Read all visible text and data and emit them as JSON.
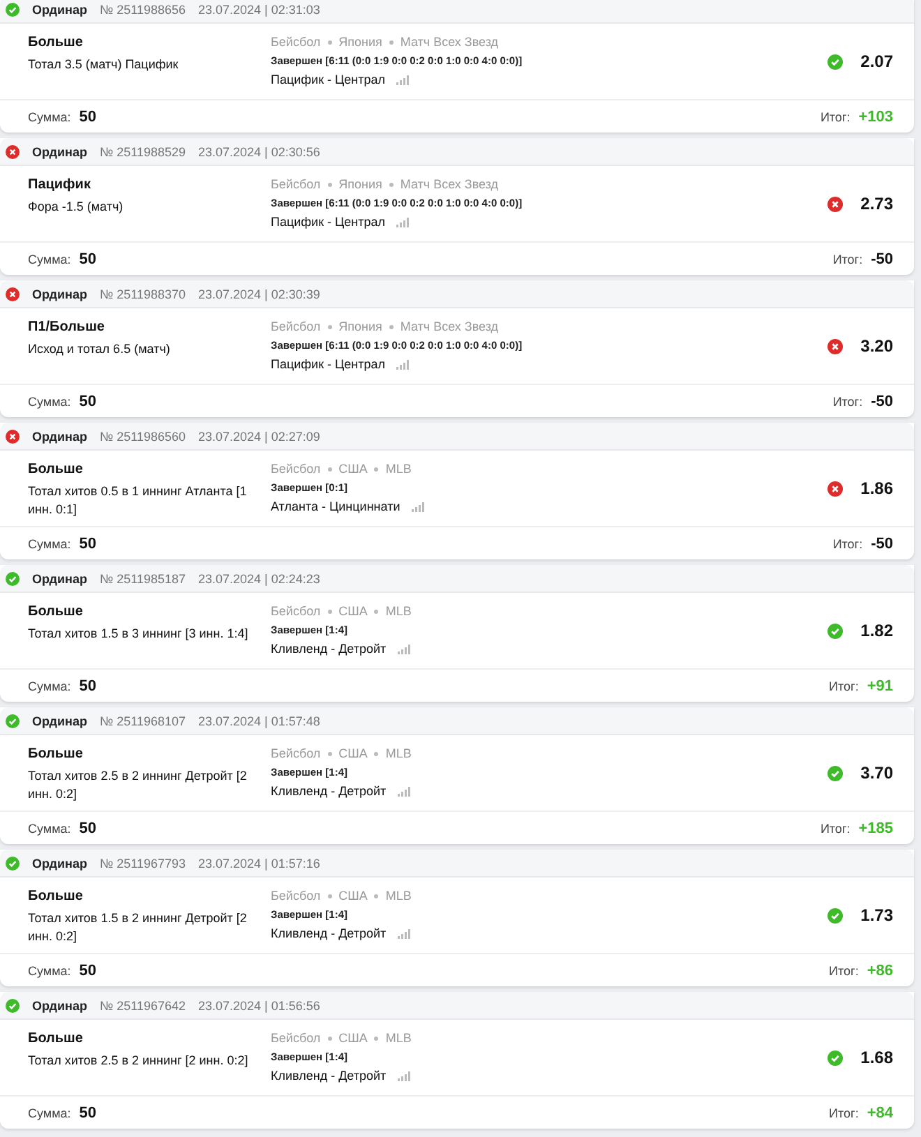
{
  "bets": [
    {
      "won": true,
      "type": "Ординар",
      "number": "№ 2511988656",
      "datetime": "23.07.2024 | 02:31:03",
      "pick": "Больше",
      "market": "Тотал 3.5 (матч) Пацифик",
      "path": [
        "Бейсбол",
        "Япония",
        "Матч Всех Звезд"
      ],
      "result": "Завершен [6:11 (0:0 1:9 0:0 0:2 0:0 1:0 0:0 4:0 0:0)]",
      "teams": "Пацифик - Централ",
      "odds": "2.07",
      "stake_label": "Сумма:",
      "stake": "50",
      "total_label": "Итог:",
      "total": "+103"
    },
    {
      "won": false,
      "type": "Ординар",
      "number": "№ 2511988529",
      "datetime": "23.07.2024 | 02:30:56",
      "pick": "Пацифик",
      "market": "Фора -1.5 (матч)",
      "path": [
        "Бейсбол",
        "Япония",
        "Матч Всех Звезд"
      ],
      "result": "Завершен [6:11 (0:0 1:9 0:0 0:2 0:0 1:0 0:0 4:0 0:0)]",
      "teams": "Пацифик - Централ",
      "odds": "2.73",
      "stake_label": "Сумма:",
      "stake": "50",
      "total_label": "Итог:",
      "total": "-50"
    },
    {
      "won": false,
      "type": "Ординар",
      "number": "№ 2511988370",
      "datetime": "23.07.2024 | 02:30:39",
      "pick": "П1/Больше",
      "market": "Исход и тотал 6.5 (матч)",
      "path": [
        "Бейсбол",
        "Япония",
        "Матч Всех Звезд"
      ],
      "result": "Завершен [6:11 (0:0 1:9 0:0 0:2 0:0 1:0 0:0 4:0 0:0)]",
      "teams": "Пацифик - Централ",
      "odds": "3.20",
      "stake_label": "Сумма:",
      "stake": "50",
      "total_label": "Итог:",
      "total": "-50"
    },
    {
      "won": false,
      "type": "Ординар",
      "number": "№ 2511986560",
      "datetime": "23.07.2024 | 02:27:09",
      "pick": "Больше",
      "market": "Тотал хитов 0.5 в 1 иннинг Атланта [1 инн. 0:1]",
      "path": [
        "Бейсбол",
        "США",
        "MLB"
      ],
      "result": "Завершен [0:1]",
      "teams": "Атланта - Цинциннати",
      "odds": "1.86",
      "stake_label": "Сумма:",
      "stake": "50",
      "total_label": "Итог:",
      "total": "-50"
    },
    {
      "won": true,
      "type": "Ординар",
      "number": "№ 2511985187",
      "datetime": "23.07.2024 | 02:24:23",
      "pick": "Больше",
      "market": "Тотал хитов 1.5 в 3 иннинг [3 инн. 1:4]",
      "path": [
        "Бейсбол",
        "США",
        "MLB"
      ],
      "result": "Завершен [1:4]",
      "teams": "Кливленд - Детройт",
      "odds": "1.82",
      "stake_label": "Сумма:",
      "stake": "50",
      "total_label": "Итог:",
      "total": "+91"
    },
    {
      "won": true,
      "type": "Ординар",
      "number": "№ 2511968107",
      "datetime": "23.07.2024 | 01:57:48",
      "pick": "Больше",
      "market": "Тотал хитов 2.5 в 2 иннинг Детройт [2 инн. 0:2]",
      "path": [
        "Бейсбол",
        "США",
        "MLB"
      ],
      "result": "Завершен [1:4]",
      "teams": "Кливленд - Детройт",
      "odds": "3.70",
      "stake_label": "Сумма:",
      "stake": "50",
      "total_label": "Итог:",
      "total": "+185"
    },
    {
      "won": true,
      "type": "Ординар",
      "number": "№ 2511967793",
      "datetime": "23.07.2024 | 01:57:16",
      "pick": "Больше",
      "market": "Тотал хитов 1.5 в 2 иннинг Детройт [2 инн. 0:2]",
      "path": [
        "Бейсбол",
        "США",
        "MLB"
      ],
      "result": "Завершен [1:4]",
      "teams": "Кливленд - Детройт",
      "odds": "1.73",
      "stake_label": "Сумма:",
      "stake": "50",
      "total_label": "Итог:",
      "total": "+86"
    },
    {
      "won": true,
      "type": "Ординар",
      "number": "№ 2511967642",
      "datetime": "23.07.2024 | 01:56:56",
      "pick": "Больше",
      "market": "Тотал хитов 2.5 в 2 иннинг [2 инн. 0:2]",
      "path": [
        "Бейсбол",
        "США",
        "MLB"
      ],
      "result": "Завершен [1:4]",
      "teams": "Кливленд - Детройт",
      "odds": "1.68",
      "stake_label": "Сумма:",
      "stake": "50",
      "total_label": "Итог:",
      "total": "+84"
    }
  ]
}
